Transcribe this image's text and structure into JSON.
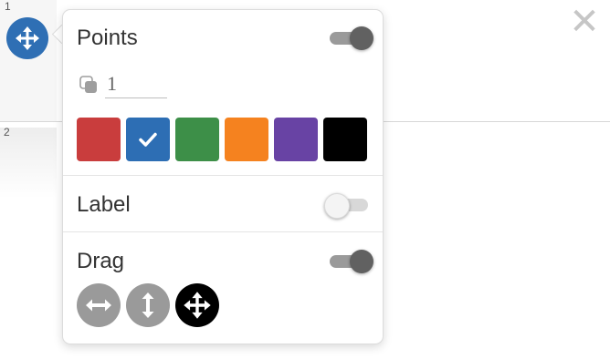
{
  "row_numbers": [
    "1",
    "2"
  ],
  "close_symbol": "✕",
  "points": {
    "title": "Points",
    "enabled": true,
    "size_value": "1",
    "colors": [
      {
        "hex": "#c93d3d",
        "selected": false
      },
      {
        "hex": "#2d6eb4",
        "selected": true
      },
      {
        "hex": "#3d8f48",
        "selected": false
      },
      {
        "hex": "#f5821f",
        "selected": false
      },
      {
        "hex": "#6843a4",
        "selected": false
      },
      {
        "hex": "#000000",
        "selected": false
      }
    ]
  },
  "label": {
    "title": "Label",
    "enabled": false
  },
  "drag": {
    "title": "Drag",
    "enabled": true,
    "modes": [
      {
        "icon": "horizontal-arrows-icon",
        "selected": false
      },
      {
        "icon": "vertical-arrows-icon",
        "selected": false
      },
      {
        "icon": "move-arrows-icon",
        "selected": true
      }
    ]
  }
}
